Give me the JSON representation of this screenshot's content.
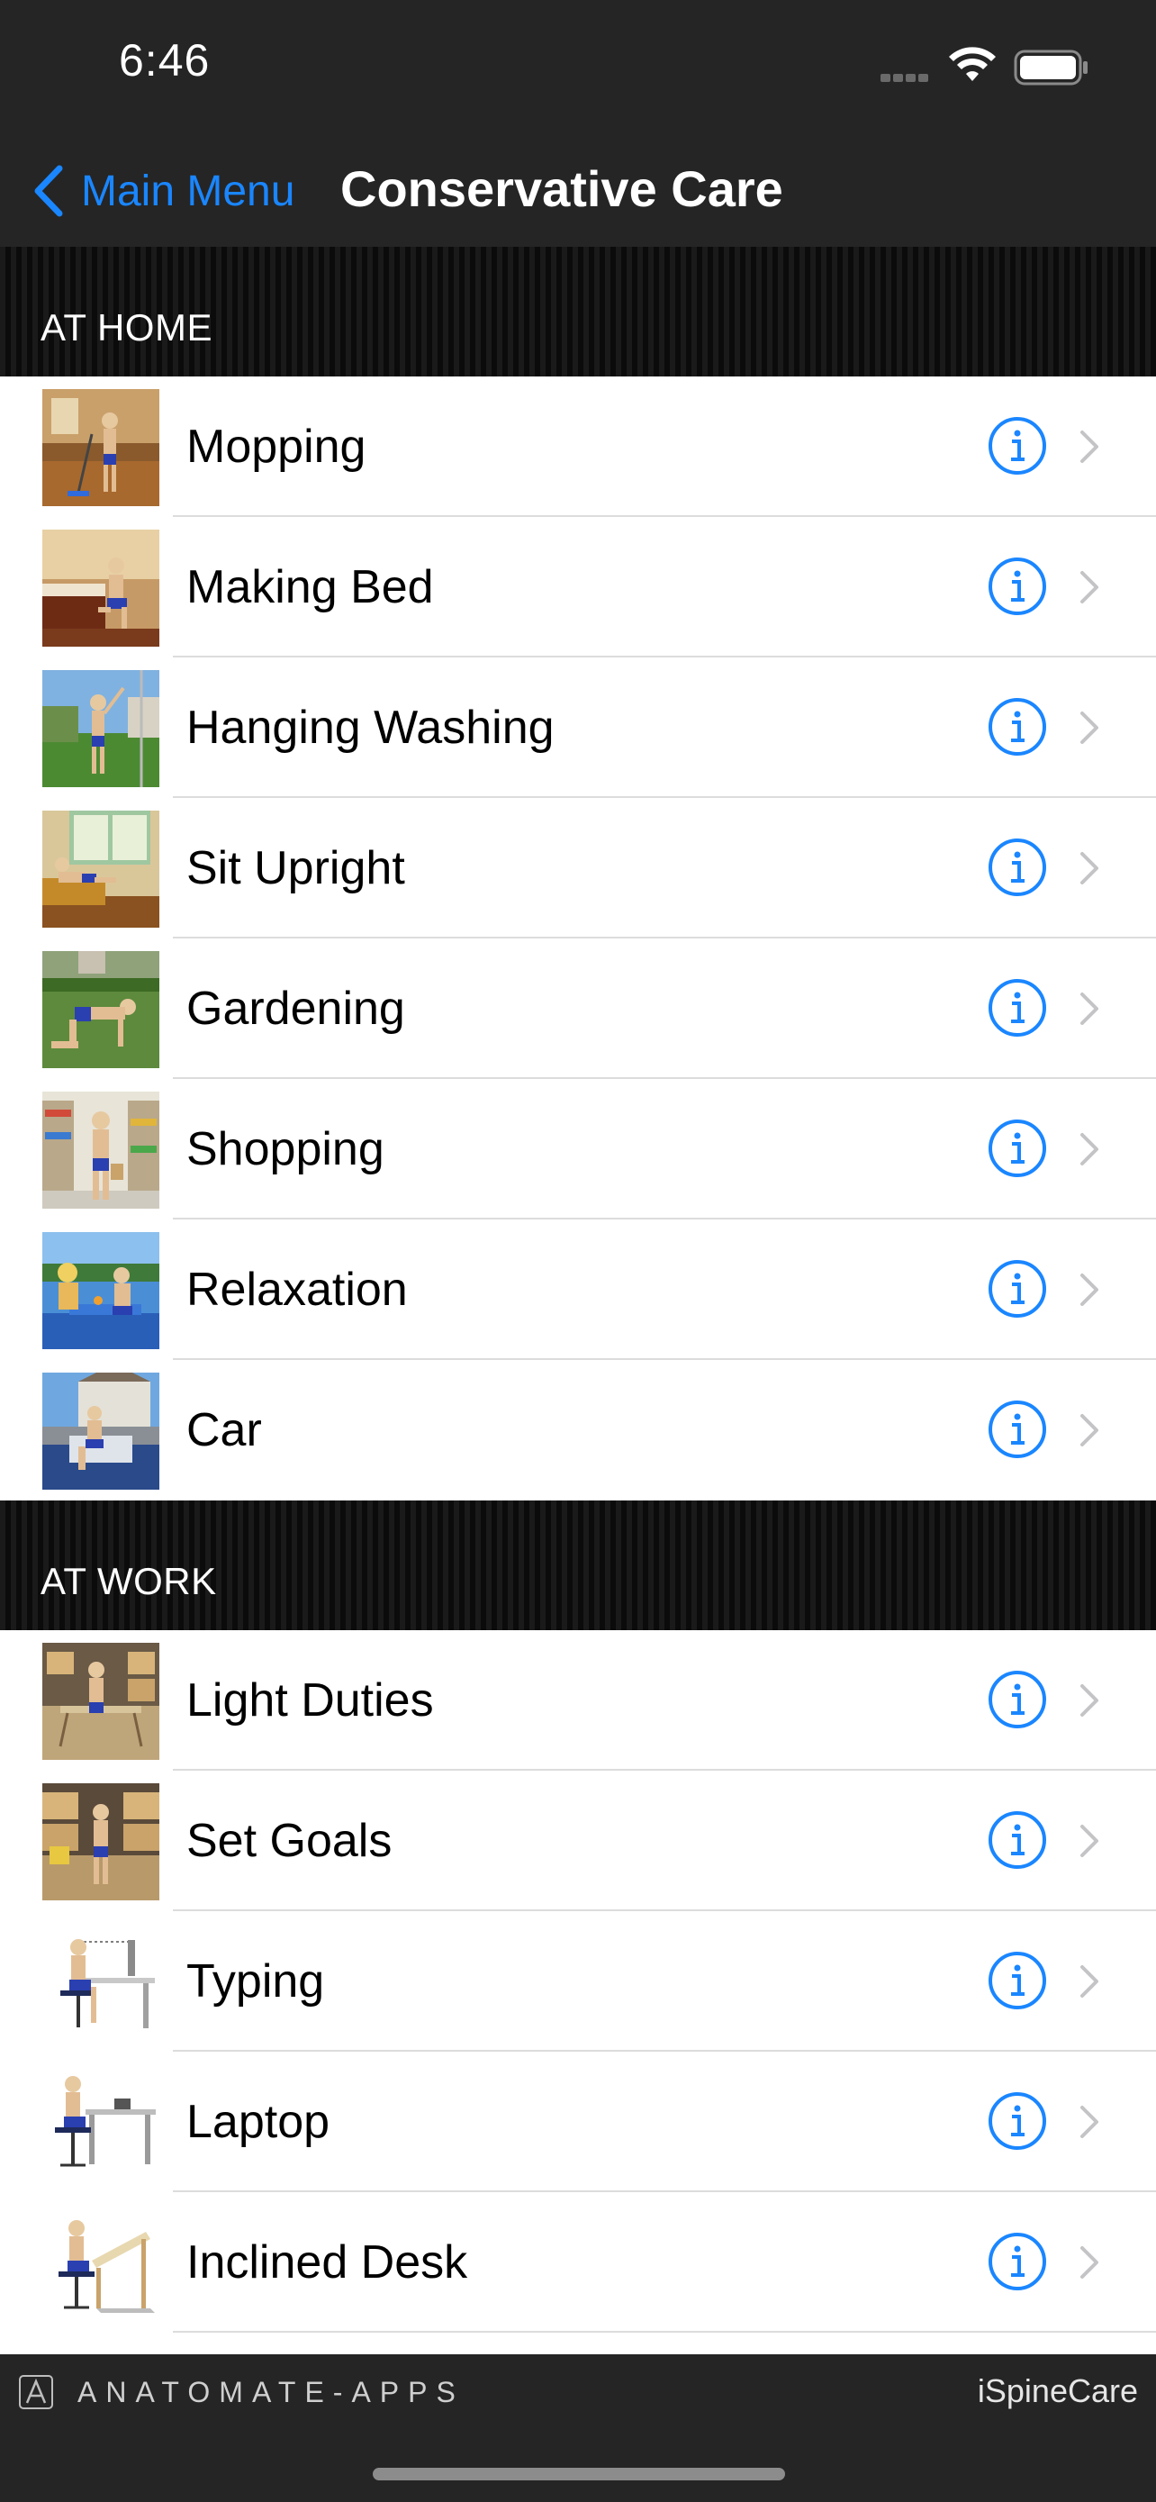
{
  "status_bar": {
    "time": "6:46"
  },
  "nav": {
    "back_label": "Main Menu",
    "title": "Conservative Care"
  },
  "colors": {
    "accent": "#1a86ff",
    "bar_background": "#252525",
    "section_background": "#141414"
  },
  "sections": [
    {
      "title": "AT HOME",
      "items": [
        {
          "label": "Mopping",
          "thumb": "mopping-thumbnail"
        },
        {
          "label": "Making Bed",
          "thumb": "making-bed-thumbnail"
        },
        {
          "label": "Hanging Washing",
          "thumb": "hanging-washing-thumbnail"
        },
        {
          "label": "Sit Upright",
          "thumb": "sit-upright-thumbnail"
        },
        {
          "label": "Gardening",
          "thumb": "gardening-thumbnail"
        },
        {
          "label": "Shopping",
          "thumb": "shopping-thumbnail"
        },
        {
          "label": "Relaxation",
          "thumb": "relaxation-thumbnail"
        },
        {
          "label": "Car",
          "thumb": "car-thumbnail"
        }
      ]
    },
    {
      "title": "AT WORK",
      "items": [
        {
          "label": "Light Duties",
          "thumb": "light-duties-thumbnail"
        },
        {
          "label": "Set Goals",
          "thumb": "set-goals-thumbnail"
        },
        {
          "label": "Typing",
          "thumb": "typing-thumbnail"
        },
        {
          "label": "Laptop",
          "thumb": "laptop-thumbnail"
        },
        {
          "label": "Inclined Desk",
          "thumb": "inclined-desk-thumbnail"
        }
      ]
    }
  ],
  "footer": {
    "brand": "ANATOMATE-APPS",
    "app_name": "iSpineCare"
  }
}
